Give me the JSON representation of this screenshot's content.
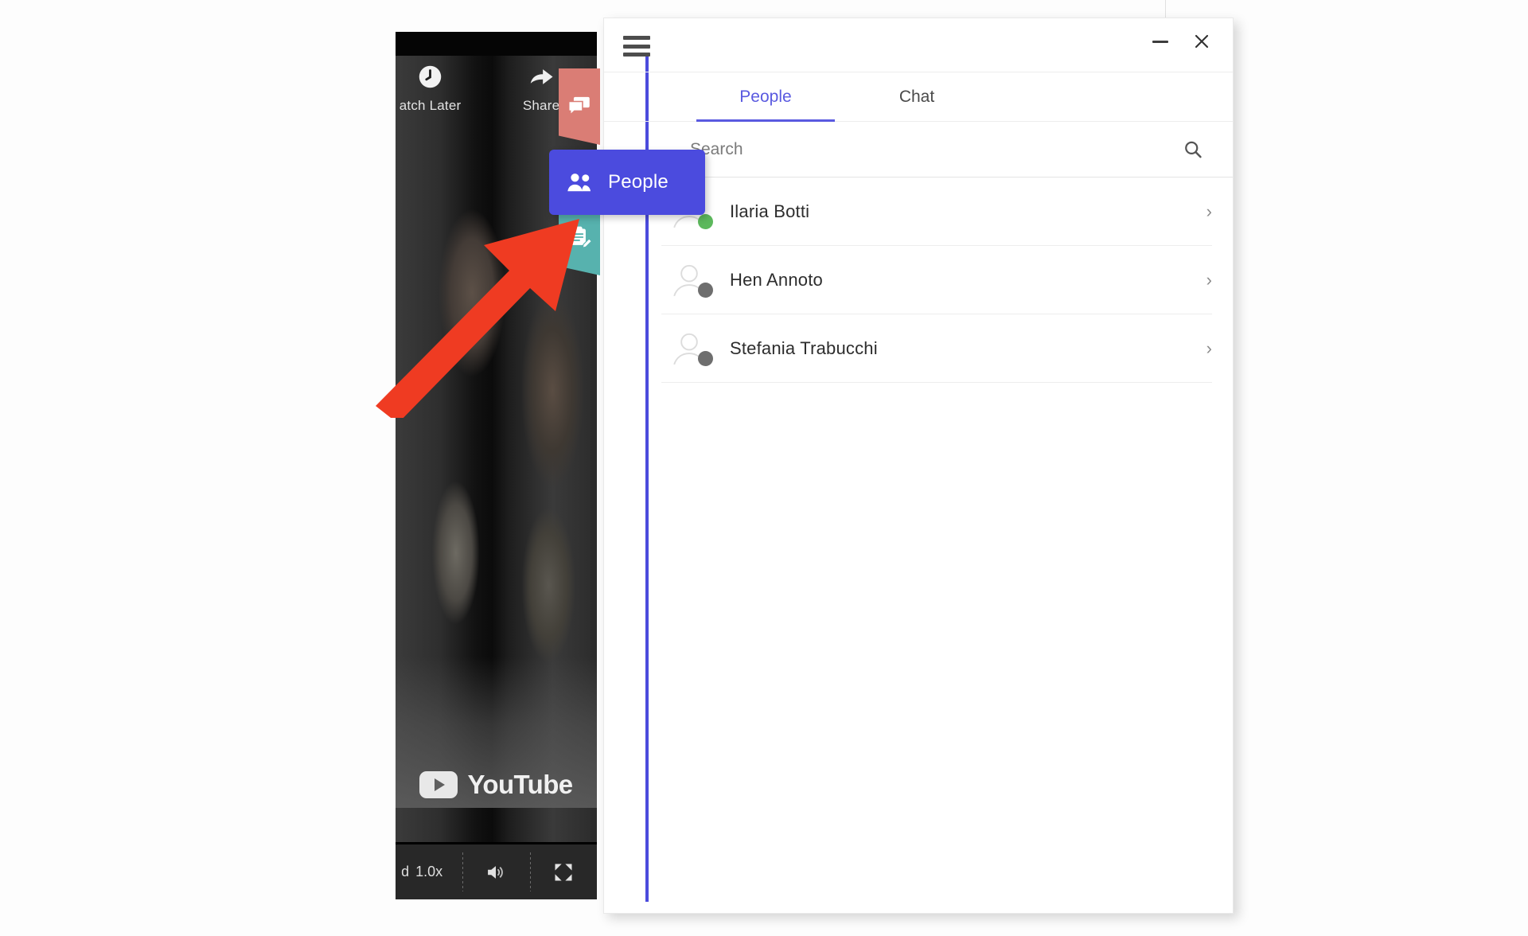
{
  "video_player": {
    "overlay_actions": [
      {
        "label": "atch Later",
        "icon": "clock-icon"
      },
      {
        "label": "Share",
        "icon": "share-icon"
      }
    ],
    "brand": "YouTube",
    "controls": {
      "speed_label_cut": "d",
      "speed_value": "1.0x",
      "volume_icon": "volume-icon",
      "fullscreen_icon": "fullscreen-icon"
    }
  },
  "widget": {
    "menu_icon": "hamburger-icon",
    "window_controls": {
      "minimize": "minimize-icon",
      "close": "close-icon"
    },
    "tabs": [
      {
        "label": "People",
        "active": true
      },
      {
        "label": "Chat",
        "active": false
      }
    ],
    "search": {
      "placeholder": "Search",
      "value": "",
      "icon": "search-icon"
    },
    "people": [
      {
        "name": "Ilaria Botti",
        "status": "online",
        "status_color": "#5cb85c",
        "chevron": "›"
      },
      {
        "name": "Hen Annoto",
        "status": "offline",
        "status_color": "#6e6e6e",
        "chevron": "›"
      },
      {
        "name": "Stefania Trabucchi",
        "status": "offline",
        "status_color": "#6e6e6e",
        "chevron": "›"
      }
    ]
  },
  "side_tabs": [
    {
      "name": "Chat",
      "icon": "chat-bubble-icon",
      "color": "#da7d75",
      "expanded": false
    },
    {
      "name": "People",
      "icon": "people-icon",
      "color": "#4b4bde",
      "expanded": true,
      "label": "People"
    },
    {
      "name": "Notes",
      "icon": "notes-clipboard-icon",
      "color": "#57b2ae",
      "expanded": false
    }
  ],
  "annotation": {
    "arrow_color": "#ef3b22",
    "points_to": "People"
  },
  "colors": {
    "accent": "#4b4bde",
    "tab_active": "#5a5ae0",
    "chat_tab": "#da7d75",
    "notes_tab": "#57b2ae",
    "online": "#5cb85c",
    "offline": "#6e6e6e"
  }
}
